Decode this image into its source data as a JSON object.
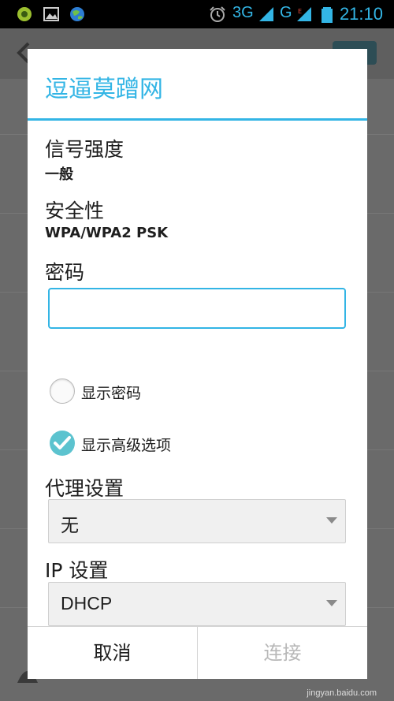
{
  "status_bar": {
    "network_3g": "3G",
    "network_g": "G",
    "time": "21:10"
  },
  "dialog": {
    "title": "逗逼莫蹭网",
    "signal_label": "信号强度",
    "signal_value": "一般",
    "security_label": "安全性",
    "security_value": "WPA/WPA2 PSK",
    "password_label": "密码",
    "password_value": "",
    "show_password_label": "显示密码",
    "show_password_checked": false,
    "show_advanced_label": "显示高级选项",
    "show_advanced_checked": true,
    "proxy_label": "代理设置",
    "proxy_value": "无",
    "ip_label": "IP 设置",
    "ip_value": "DHCP",
    "cancel_label": "取消",
    "connect_label": "连接"
  },
  "watermark": "jingyan.baidu.com",
  "colors": {
    "accent": "#33b5e5",
    "check": "#5cc3cf",
    "disabled_text": "#b8b8b8"
  }
}
